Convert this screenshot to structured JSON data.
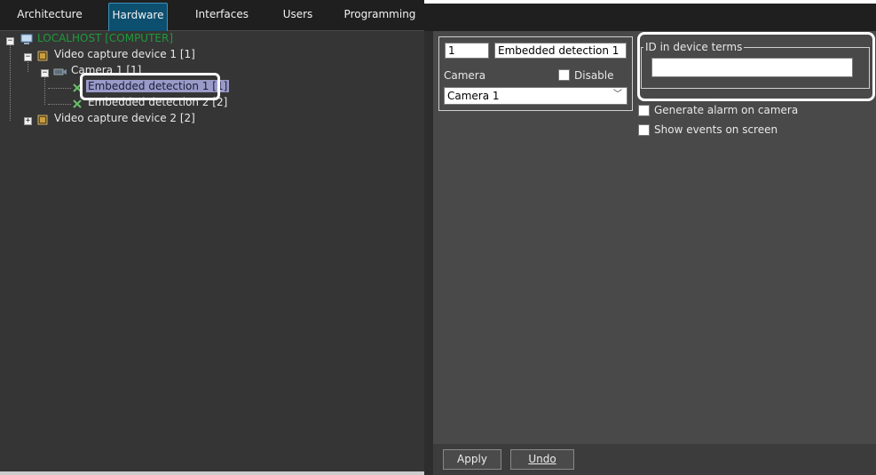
{
  "tabs": [
    {
      "label": "Architecture"
    },
    {
      "label": "Hardware",
      "active": true
    },
    {
      "label": "Interfaces"
    },
    {
      "label": "Users"
    },
    {
      "label": "Programming"
    }
  ],
  "tree": {
    "root": "LOCALHOST [COMPUTER]",
    "device1": "Video capture device 1 [1]",
    "camera1": "Camera 1 [1]",
    "detection1": "Embedded detection 1 [1]",
    "detection2": "Embedded detection 2 [2]",
    "device2": "Video capture device 2 [2]"
  },
  "form": {
    "id_value": "1",
    "name_value": "Embedded detection 1",
    "camera_label": "Camera",
    "disable_label": "Disable",
    "camera_select": "Camera 1",
    "id_group_label": "ID in device terms",
    "id_device_value": "",
    "generate_alarm_label": "Generate alarm on camera",
    "show_events_label": "Show events on screen"
  },
  "buttons": {
    "apply": "Apply",
    "undo": "Undo"
  },
  "colors": {
    "root_green": "#1e9b3c",
    "active_tab": "#0d4f6f",
    "selected_node": "#9a9ac8"
  }
}
